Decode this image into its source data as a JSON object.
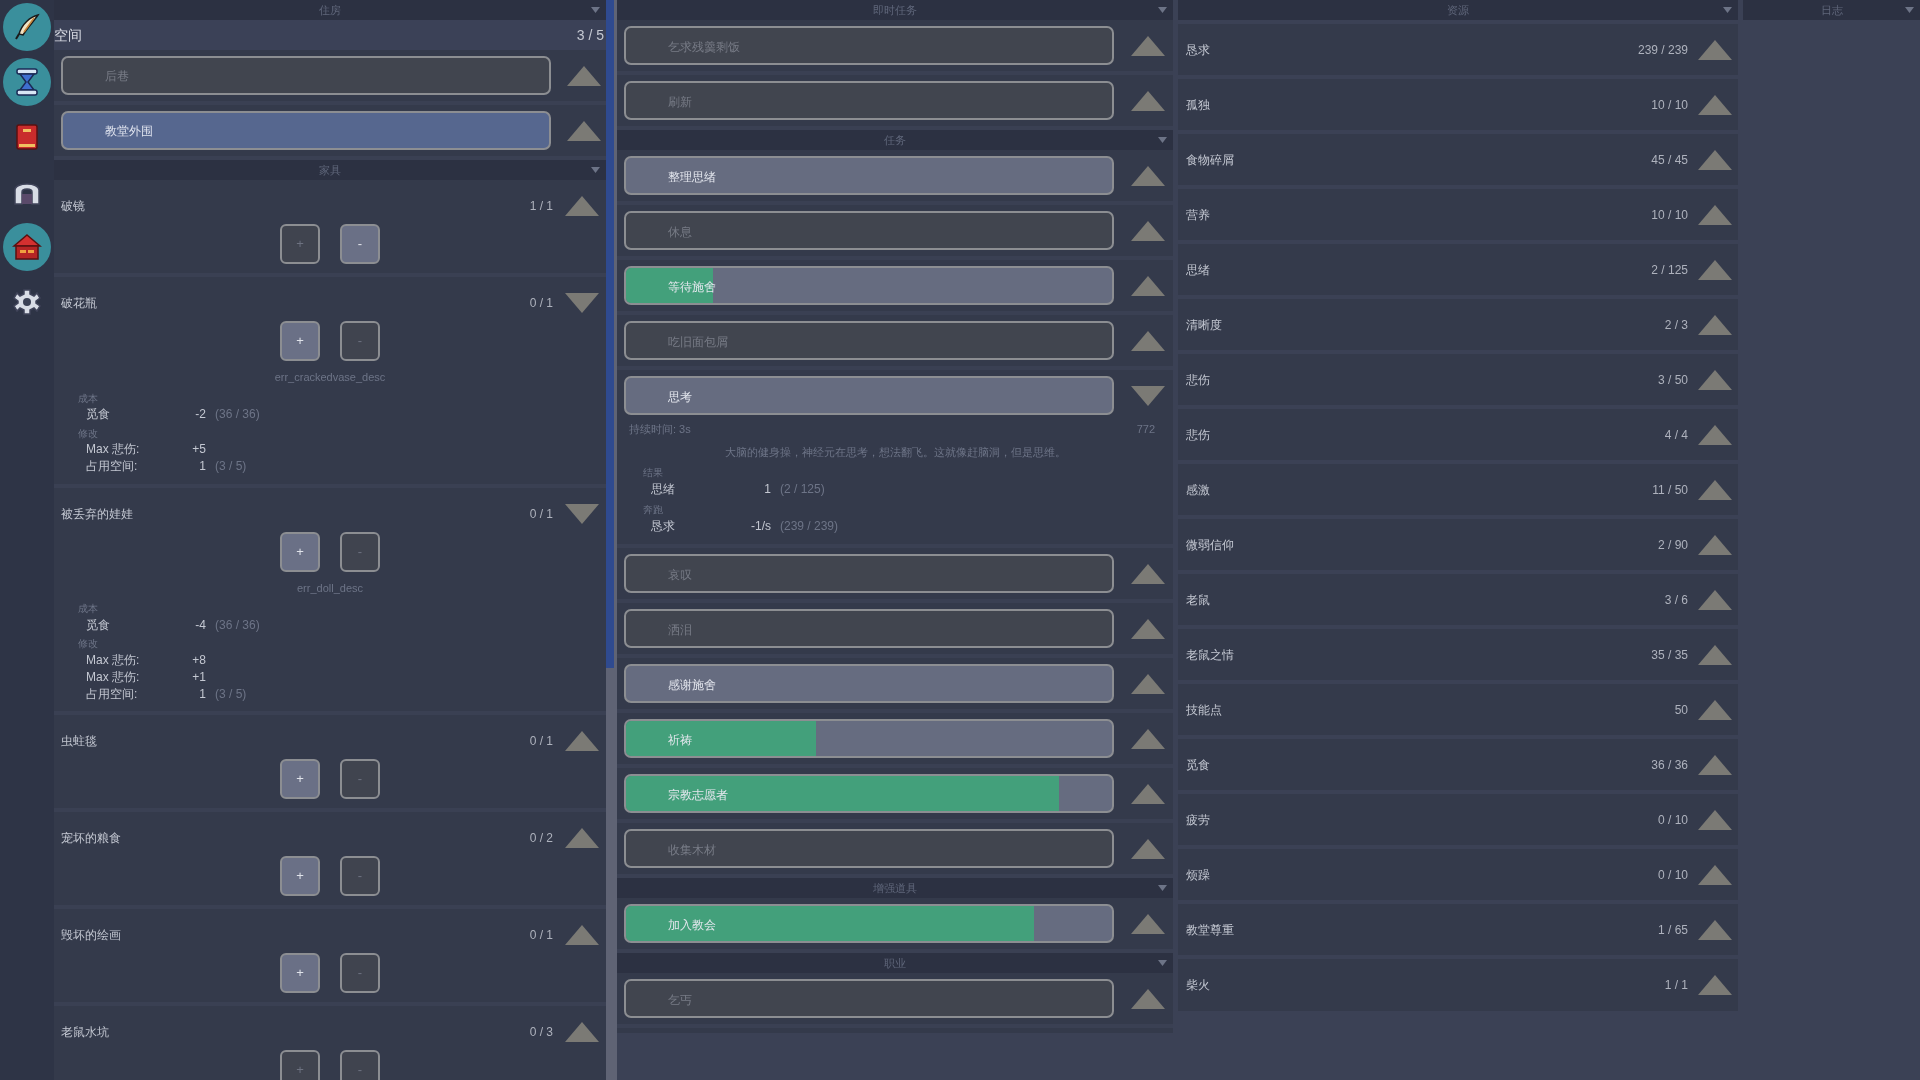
{
  "sidebar": {
    "items": [
      {
        "kind": "feather",
        "highlighted": true
      },
      {
        "kind": "hourglass",
        "highlighted": true
      },
      {
        "kind": "book",
        "highlighted": false
      },
      {
        "kind": "arch",
        "highlighted": false
      },
      {
        "kind": "house",
        "highlighted": true
      },
      {
        "kind": "gear",
        "highlighted": false
      }
    ]
  },
  "housing": {
    "header": "住房",
    "space_label": "空间",
    "space_value": "3 / 5",
    "locations": [
      {
        "label": "后巷",
        "selected": false
      },
      {
        "label": "教堂外围",
        "selected": true
      }
    ]
  },
  "furniture": {
    "header": "家具",
    "items": [
      {
        "name": "破镜",
        "count": "1 / 1",
        "expanded": false,
        "add": "+",
        "remove": "-",
        "can_add": false,
        "can_remove": true
      },
      {
        "name": "破花瓶",
        "count": "0 / 1",
        "expanded": true,
        "add": "+",
        "remove": "-",
        "can_add": true,
        "can_remove": false,
        "description": "err_crackedvase_desc",
        "cost_label": "成本",
        "cost": [
          {
            "name": "觅食",
            "amount": "-2",
            "stock": "(36 / 36)"
          }
        ],
        "mod_label": "修改",
        "modifiers": [
          {
            "name": "Max 悲伤:",
            "amount": "+5"
          },
          {
            "name": "占用空间:",
            "amount": "1",
            "stock": "(3 / 5)"
          }
        ]
      },
      {
        "name": "被丢弃的娃娃",
        "count": "0 / 1",
        "expanded": true,
        "add": "+",
        "remove": "-",
        "can_add": true,
        "can_remove": false,
        "description": "err_doll_desc",
        "cost_label": "成本",
        "cost": [
          {
            "name": "觅食",
            "amount": "-4",
            "stock": "(36 / 36)"
          }
        ],
        "mod_label": "修改",
        "modifiers": [
          {
            "name": "Max 悲伤:",
            "amount": "+8"
          },
          {
            "name": "Max 悲伤:",
            "amount": "+1"
          },
          {
            "name": "占用空间:",
            "amount": "1",
            "stock": "(3 / 5)"
          }
        ]
      },
      {
        "name": "虫蛀毯",
        "count": "0 / 1",
        "expanded": false,
        "add": "+",
        "remove": "-",
        "can_add": true,
        "can_remove": false
      },
      {
        "name": "宠坏的粮食",
        "count": "0 / 2",
        "expanded": false,
        "add": "+",
        "remove": "-",
        "can_add": true,
        "can_remove": false
      },
      {
        "name": "毁坏的绘画",
        "count": "0 / 1",
        "expanded": false,
        "add": "+",
        "remove": "-",
        "can_add": true,
        "can_remove": false
      },
      {
        "name": "老鼠水坑",
        "count": "0 / 3",
        "expanded": false,
        "add": "+",
        "remove": "-",
        "can_add": false,
        "can_remove": false
      }
    ]
  },
  "tasks": {
    "sections": [
      {
        "header": "即时任务",
        "items": [
          {
            "label": "乞求残羹剩饭",
            "enabled": false,
            "expanded": false
          },
          {
            "label": "刷新",
            "enabled": false,
            "expanded": false
          }
        ]
      },
      {
        "header": "任务",
        "items": [
          {
            "label": "整理思绪",
            "enabled": true,
            "expanded": false
          },
          {
            "label": "休息",
            "enabled": false,
            "expanded": false
          },
          {
            "label": "等待施舍",
            "enabled": true,
            "expanded": false,
            "level": 0.18
          },
          {
            "label": "吃旧面包屑",
            "enabled": false,
            "expanded": false
          },
          {
            "label": "思考",
            "enabled": true,
            "expanded": true,
            "detail": {
              "duration": "持续时间: 3s",
              "count": "772",
              "description": "大脑的健身操，神经元在思考，想法翻飞。这就像赶脑洞，但是思维。",
              "groups": [
                {
                  "label": "结果",
                  "rows": [
                    {
                      "name": "思绪",
                      "amount": "1",
                      "stock": "(2 / 125)"
                    }
                  ]
                },
                {
                  "label": "奔跑",
                  "rows": [
                    {
                      "name": "恳求",
                      "amount": "-1/s",
                      "stock": "(239 / 239)"
                    }
                  ]
                }
              ]
            }
          },
          {
            "label": "哀叹",
            "enabled": false,
            "expanded": false
          },
          {
            "label": "洒泪",
            "enabled": false,
            "expanded": false
          },
          {
            "label": "感谢施舍",
            "enabled": true,
            "expanded": false
          },
          {
            "label": "祈祷",
            "enabled": true,
            "expanded": false,
            "level": 0.39
          },
          {
            "label": "宗教志愿者",
            "enabled": true,
            "expanded": false,
            "level": 0.89
          },
          {
            "label": "收集木材",
            "enabled": false,
            "expanded": false
          }
        ]
      },
      {
        "header": "增强道具",
        "items": [
          {
            "label": "加入教会",
            "enabled": true,
            "expanded": false,
            "level": 0.84
          }
        ]
      },
      {
        "header": "职业",
        "items": [
          {
            "label": "乞丐",
            "enabled": false,
            "expanded": false
          }
        ]
      }
    ]
  },
  "resources": {
    "header": "资源",
    "items": [
      {
        "name": "恳求",
        "value": "239 / 239"
      },
      {
        "name": "孤独",
        "value": "10 / 10"
      },
      {
        "name": "食物碎屑",
        "value": "45 / 45"
      },
      {
        "name": "营养",
        "value": "10 / 10"
      },
      {
        "name": "思绪",
        "value": "2 / 125"
      },
      {
        "name": "清晰度",
        "value": "2 / 3"
      },
      {
        "name": "悲伤",
        "value": "3 / 50"
      },
      {
        "name": "悲伤",
        "value": "4 / 4"
      },
      {
        "name": "感激",
        "value": "11 / 50"
      },
      {
        "name": "微弱信仰",
        "value": "2 / 90"
      },
      {
        "name": "老鼠",
        "value": "3 / 6"
      },
      {
        "name": "老鼠之情",
        "value": "35 / 35"
      },
      {
        "name": "技能点",
        "value": "50"
      },
      {
        "name": "觅食",
        "value": "36 / 36"
      },
      {
        "name": "疲劳",
        "value": "0 / 10"
      },
      {
        "name": "烦躁",
        "value": "0 / 10"
      },
      {
        "name": "教堂尊重",
        "value": "1 / 65"
      },
      {
        "name": "柴火",
        "value": "1 / 1"
      }
    ]
  },
  "log": {
    "header": "日志"
  }
}
